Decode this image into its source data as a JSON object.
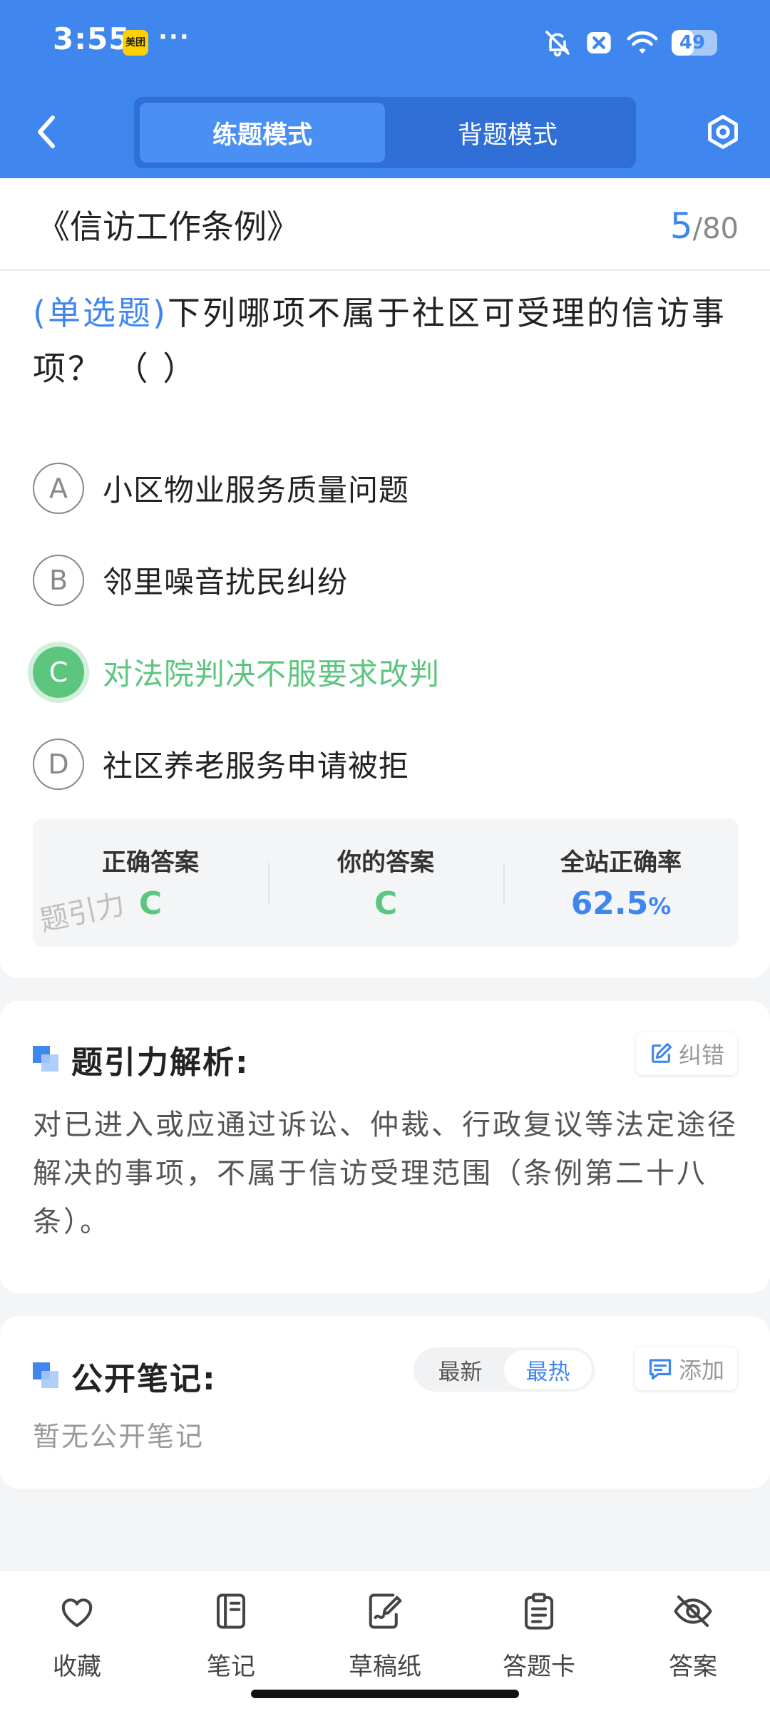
{
  "status_bar": {
    "time": "3:55",
    "app_badge": "美团",
    "more": "···",
    "battery_level": 49,
    "battery_text": "49"
  },
  "header": {
    "tabs": [
      {
        "label": "练题模式",
        "active": true
      },
      {
        "label": "背题模式",
        "active": false
      }
    ]
  },
  "question": {
    "chapter": "《信访工作条例》",
    "current": "5",
    "separator": "/",
    "total": "80",
    "type": "(单选题)",
    "text": "下列哪项不属于社区可受理的信访事项？ （      ）",
    "options": [
      {
        "letter": "A",
        "text": "小区物业服务质量问题"
      },
      {
        "letter": "B",
        "text": "邻里噪音扰民纠纷"
      },
      {
        "letter": "C",
        "text": "对法院判决不服要求改判",
        "selected_correct": true
      },
      {
        "letter": "D",
        "text": "社区养老服务申请被拒"
      }
    ]
  },
  "answer": {
    "correct_label": "正确答案",
    "correct_value": "C",
    "yours_label": "你的答案",
    "yours_value": "C",
    "rate_label": "全站正确率",
    "rate_value": "62.5",
    "rate_unit": "%",
    "watermark": "题引力"
  },
  "analysis": {
    "title": "题引力解析:",
    "fix_button": "纠错",
    "text": "对已进入或应通过诉讼、仲裁、行政复议等法定途径解决的事项，不属于信访受理范围（条例第二十八条）。"
  },
  "notes": {
    "title": "公开笔记:",
    "sort_options": [
      {
        "label": "最新",
        "active": false
      },
      {
        "label": "最热",
        "active": true
      }
    ],
    "add_button": "添加",
    "empty": "暂无公开笔记"
  },
  "bottom_bar": {
    "items": [
      {
        "label": "收藏",
        "icon": "heart-icon"
      },
      {
        "label": "笔记",
        "icon": "notebook-icon"
      },
      {
        "label": "草稿纸",
        "icon": "draft-icon"
      },
      {
        "label": "答题卡",
        "icon": "answer-sheet-icon"
      },
      {
        "label": "答案",
        "icon": "eye-off-icon"
      }
    ]
  },
  "colors": {
    "primary": "#3f86ef",
    "correct": "#5cc67e",
    "page_bg": "#f4f5f7"
  }
}
